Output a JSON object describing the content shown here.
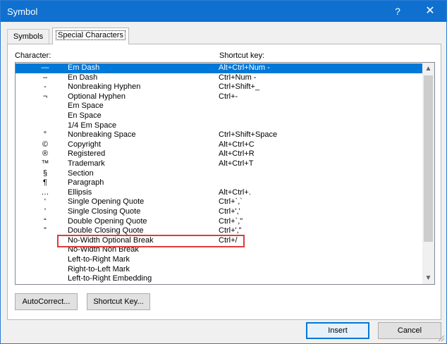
{
  "window": {
    "title": "Symbol",
    "help_label": "?",
    "close_label": "✕"
  },
  "tabs": [
    {
      "label": "Symbols",
      "active": false
    },
    {
      "label": "Special Characters",
      "active": true
    }
  ],
  "columns": {
    "character": "Character:",
    "shortcut": "Shortcut key:"
  },
  "rows": [
    {
      "symbol": "—",
      "name": "Em Dash",
      "shortcut": "Alt+Ctrl+Num -",
      "selected": true
    },
    {
      "symbol": "–",
      "name": "En Dash",
      "shortcut": "Ctrl+Num -"
    },
    {
      "symbol": "-",
      "name": "Nonbreaking Hyphen",
      "shortcut": "Ctrl+Shift+_"
    },
    {
      "symbol": "¬",
      "name": "Optional Hyphen",
      "shortcut": "Ctrl+-"
    },
    {
      "symbol": "",
      "name": "Em Space",
      "shortcut": ""
    },
    {
      "symbol": "",
      "name": "En Space",
      "shortcut": ""
    },
    {
      "symbol": "",
      "name": "1/4 Em Space",
      "shortcut": ""
    },
    {
      "symbol": "°",
      "name": "Nonbreaking Space",
      "shortcut": "Ctrl+Shift+Space"
    },
    {
      "symbol": "©",
      "name": "Copyright",
      "shortcut": "Alt+Ctrl+C"
    },
    {
      "symbol": "®",
      "name": "Registered",
      "shortcut": "Alt+Ctrl+R"
    },
    {
      "symbol": "™",
      "name": "Trademark",
      "shortcut": "Alt+Ctrl+T"
    },
    {
      "symbol": "§",
      "name": "Section",
      "shortcut": ""
    },
    {
      "symbol": "¶",
      "name": "Paragraph",
      "shortcut": ""
    },
    {
      "symbol": "…",
      "name": "Ellipsis",
      "shortcut": "Alt+Ctrl+."
    },
    {
      "symbol": "‘",
      "name": "Single Opening Quote",
      "shortcut": "Ctrl+`,`"
    },
    {
      "symbol": "’",
      "name": "Single Closing Quote",
      "shortcut": "Ctrl+','"
    },
    {
      "symbol": "“",
      "name": "Double Opening Quote",
      "shortcut": "Ctrl+`,\""
    },
    {
      "symbol": "”",
      "name": "Double Closing Quote",
      "shortcut": "Ctrl+',\""
    },
    {
      "symbol": "",
      "name": "No-Width Optional Break",
      "shortcut": "Ctrl+/"
    },
    {
      "symbol": "",
      "name": "No-Width Non Break",
      "shortcut": ""
    },
    {
      "symbol": "",
      "name": "Left-to-Right Mark",
      "shortcut": ""
    },
    {
      "symbol": "",
      "name": "Right-to-Left Mark",
      "shortcut": ""
    },
    {
      "symbol": "",
      "name": "Left-to-Right Embedding",
      "shortcut": ""
    }
  ],
  "buttons": {
    "autocorrect": "AutoCorrect...",
    "shortcut_key": "Shortcut Key...",
    "insert": "Insert",
    "cancel": "Cancel"
  },
  "colors": {
    "titlebar": "#0f70cf",
    "selection": "#0078d7",
    "highlight_box": "#e03a3a"
  },
  "icons": {
    "scroll_up": "chevron-up-icon",
    "scroll_down": "chevron-down-icon",
    "resize": "resize-grip-icon"
  }
}
